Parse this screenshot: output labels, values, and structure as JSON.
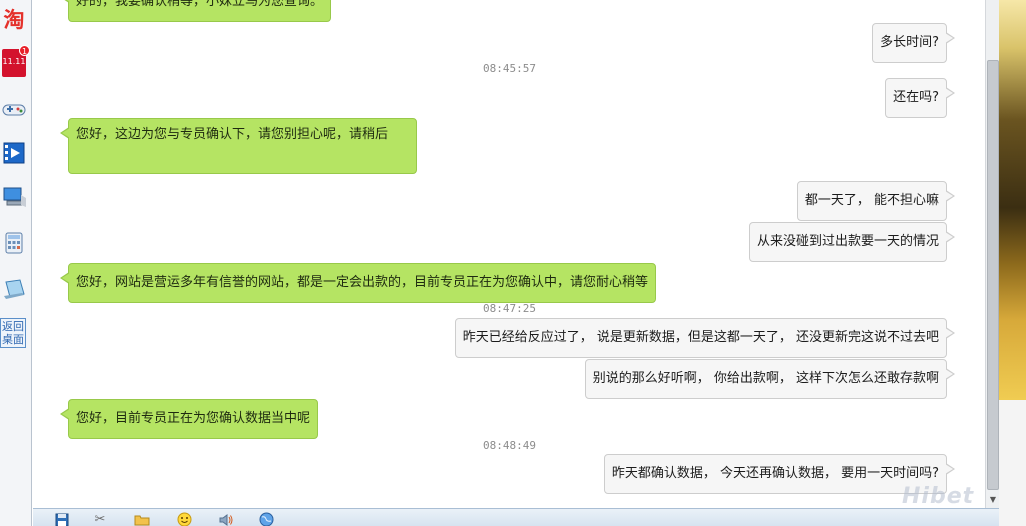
{
  "dock": {
    "taobao_label": "淘",
    "promo_label": "11.11",
    "promo_badge": "1",
    "back_to_desktop_label": "返回桌面"
  },
  "chat": {
    "messages": [
      {
        "side": "in",
        "text": "好的，我要确认稍等，小妹立马为您查询。"
      },
      {
        "side": "out",
        "text": "多长时间?"
      },
      {
        "side": "ts",
        "text": "08:45:57"
      },
      {
        "side": "out",
        "text": "还在吗?"
      },
      {
        "side": "in",
        "text": "您好，这边为您与专员确认下，请您别担心呢，请稍后"
      },
      {
        "side": "out",
        "text": "都一天了，   能不担心嘛"
      },
      {
        "side": "out",
        "text": "从来没碰到过出款要一天的情况"
      },
      {
        "side": "in",
        "text": "您好，网站是营运多年有信誉的网站，都是一定会出款的，目前专员正在为您确认中，请您耐心稍等"
      },
      {
        "side": "ts",
        "text": "08:47:25"
      },
      {
        "side": "out",
        "text": "昨天已经给反应过了，   说是更新数据，但是这都一天了，   还没更新完这说不过去吧"
      },
      {
        "side": "out",
        "text": "别说的那么好听啊，   你给出款啊，   这样下次怎么还敢存款啊"
      },
      {
        "side": "in",
        "text": "您好，目前专员正在为您确认数据当中呢"
      },
      {
        "side": "ts",
        "text": "08:48:49"
      },
      {
        "side": "out",
        "text": "昨天都确认数据，   今天还再确认数据，   要用一天时间吗?"
      }
    ]
  },
  "watermark": "Hibet",
  "colors": {
    "incoming_bubble": "#b5e463",
    "outgoing_bubble": "#f6f6f6",
    "timestamp": "#8c8c8c"
  },
  "toolbar_icons": [
    "save-icon",
    "scissors-icon",
    "folder-icon",
    "emoji-icon",
    "sound-icon",
    "globe-icon"
  ]
}
